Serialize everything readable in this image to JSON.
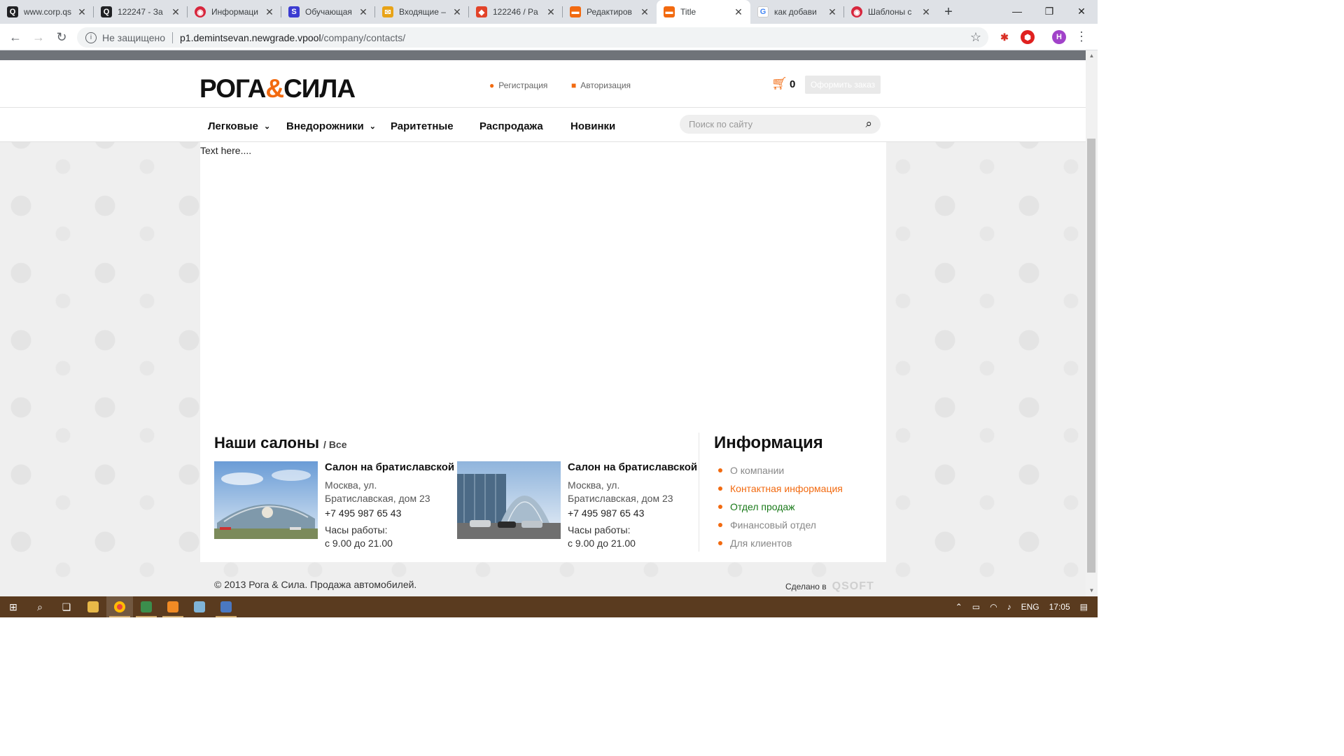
{
  "browser": {
    "tabs": [
      {
        "title": "www.corp.qs",
        "icon": "q-icon",
        "color": "#202124"
      },
      {
        "title": "122247 - За",
        "icon": "q-icon",
        "color": "#202124"
      },
      {
        "title": "Информаци",
        "icon": "bitrix-icon",
        "color": "#d7263d"
      },
      {
        "title": "Обучающая",
        "icon": "s-icon",
        "color": "#3b3bd1"
      },
      {
        "title": "Входящие –",
        "icon": "mail-icon",
        "color": "#e8a317"
      },
      {
        "title": "122246 / Pa",
        "icon": "gitlab-icon",
        "color": "#e24329"
      },
      {
        "title": "Редактиров",
        "icon": "car-icon",
        "color": "#f26a10"
      },
      {
        "title": "Title",
        "icon": "car-icon",
        "color": "#f26a10"
      },
      {
        "title": "как добави",
        "icon": "google-icon",
        "color": "#4285f4"
      },
      {
        "title": "Шаблоны с",
        "icon": "bitrix-icon",
        "color": "#d7263d"
      }
    ],
    "new_tab": "+",
    "security": "Не защищено",
    "url_host": "p1.demintsevan.newgrade.vpool",
    "url_path": "/company/contacts/",
    "profile_letter": "Н"
  },
  "site": {
    "logo_left": "РОГА",
    "logo_amp": "&",
    "logo_right": "СИЛА",
    "register": "Регистрация",
    "login": "Авторизация",
    "cart_count": "0",
    "order_button": "Оформить заказ",
    "menu": [
      "Легковые",
      "Внедорожники",
      "Раритетные",
      "Распродажа",
      "Новинки"
    ],
    "search_placeholder": "Поиск по сайту",
    "content_text": "Text here....",
    "salons_title": "Наши салоны",
    "salons_all": "/ Все",
    "salons": [
      {
        "name": "Салон на братиславской",
        "address": "Москва, ул. Братиславская, дом 23",
        "phone": "+7 495 987 65 43",
        "hours_label": "Часы работы:",
        "hours": "с 9.00 до 21.00"
      },
      {
        "name": "Салон на братиславской",
        "address": "Москва, ул. Братиславская, дом 23",
        "phone": "+7 495 987 65 43",
        "hours_label": "Часы работы:",
        "hours": "с 9.00 до 21.00"
      }
    ],
    "info_title": "Информация",
    "info_links": [
      "О компании",
      "Контактная информация",
      "Отдел продаж",
      "Финансовый отдел",
      "Для клиентов"
    ],
    "copyright": "© 2013 Рога & Сила. Продажа автомобилей.",
    "made_by": "Сделано в",
    "made_brand": "QSOFT"
  },
  "taskbar": {
    "lang": "ENG",
    "time": "17:05"
  },
  "colors": {
    "accent": "#f26a10",
    "taskbar": "#5a3b1f"
  }
}
